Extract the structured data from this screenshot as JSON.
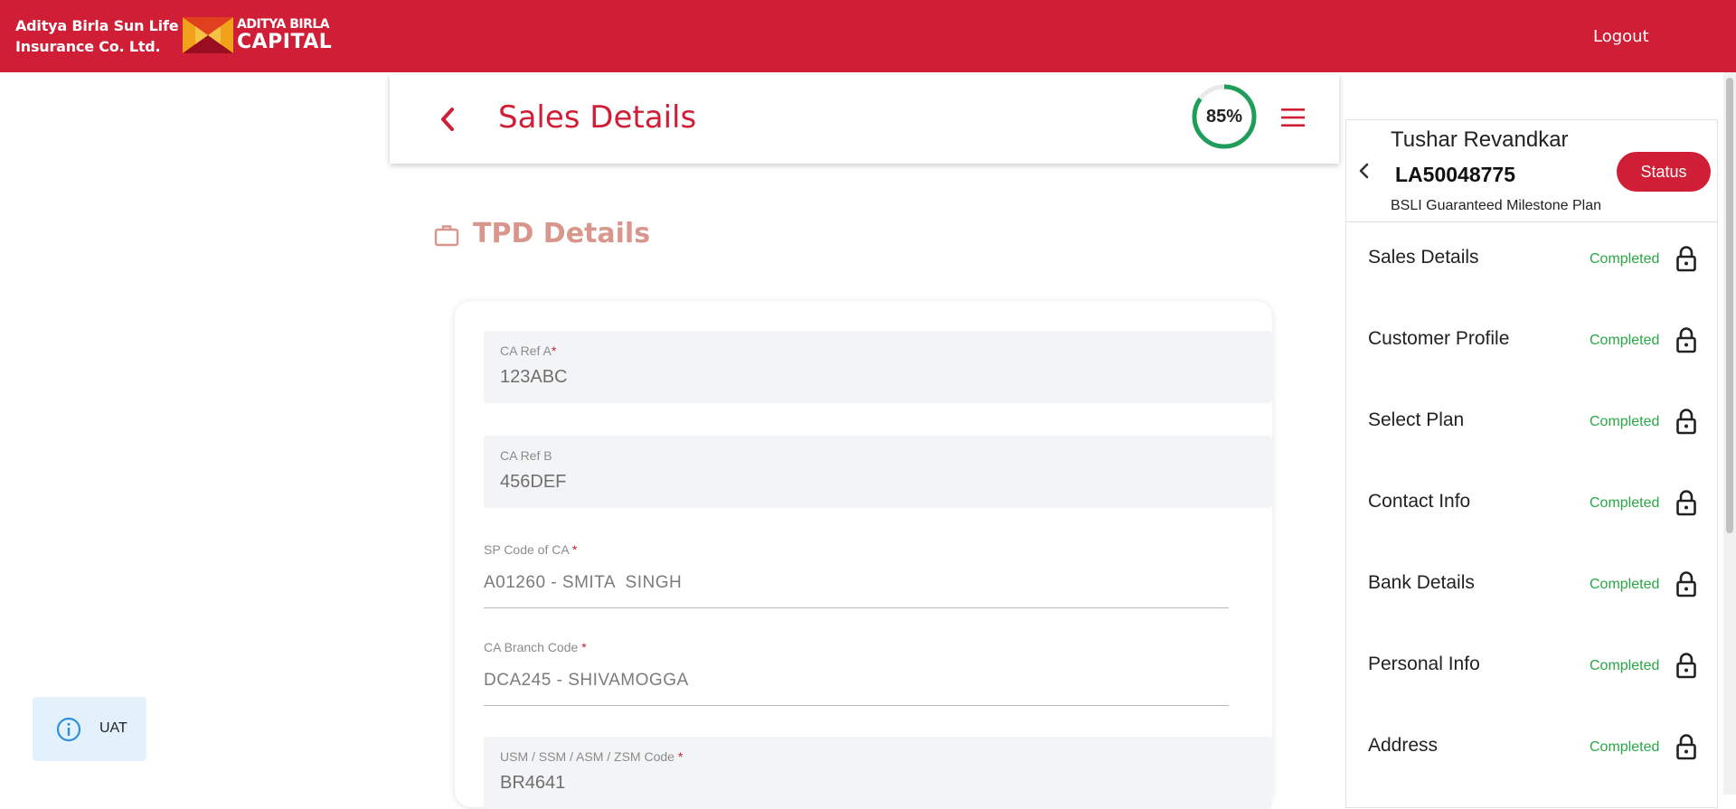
{
  "header": {
    "brand_line1": "Aditya Birla Sun Life",
    "brand_line2": "Insurance Co. Ltd.",
    "logo_line1": "ADITYA BIRLA",
    "logo_line2": "CAPITAL",
    "logout_label": "Logout",
    "color": "#cf1e35"
  },
  "page": {
    "title": "Sales Details",
    "progress_value": 85,
    "progress_label": "85%",
    "section_title": "TPD Details"
  },
  "form": {
    "ca_ref_a": {
      "label": "CA Ref A",
      "required": "*",
      "value": "123ABC"
    },
    "ca_ref_b": {
      "label": "CA Ref B",
      "value": "456DEF"
    },
    "sp_code": {
      "label": "SP Code of CA",
      "required": "*",
      "value": "A01260 - SMITA  SINGH"
    },
    "branch_code": {
      "label": "CA Branch Code",
      "required": "*",
      "value": "DCA245 - SHIVAMOGGA"
    },
    "usm_code": {
      "label": "USM / SSM / ASM / ZSM Code",
      "required": "*",
      "value": "BR4641"
    }
  },
  "env_badge": {
    "label": "UAT"
  },
  "side_panel": {
    "customer_name": "Tushar Revandkar",
    "application_no": "LA50048775",
    "plan_name": "BSLI Guaranteed Milestone Plan",
    "status_button": "Status",
    "items": [
      {
        "label": "Sales Details",
        "status": "Completed",
        "icon": "lock-icon"
      },
      {
        "label": "Customer Profile",
        "status": "Completed",
        "icon": "lock-icon"
      },
      {
        "label": "Select Plan",
        "status": "Completed",
        "icon": "lock-icon"
      },
      {
        "label": "Contact Info",
        "status": "Completed",
        "icon": "lock-icon"
      },
      {
        "label": "Bank Details",
        "status": "Completed",
        "icon": "lock-icon"
      },
      {
        "label": "Personal Info",
        "status": "Completed",
        "icon": "lock-icon"
      },
      {
        "label": "Address",
        "status": "Completed",
        "icon": "lock-icon"
      }
    ]
  },
  "colors": {
    "brand_red": "#cf1e35",
    "progress_green": "#1e9e5a",
    "completed_green": "#28a745",
    "section_title": "#d9968c",
    "uat_bg": "#e3f1fc"
  }
}
